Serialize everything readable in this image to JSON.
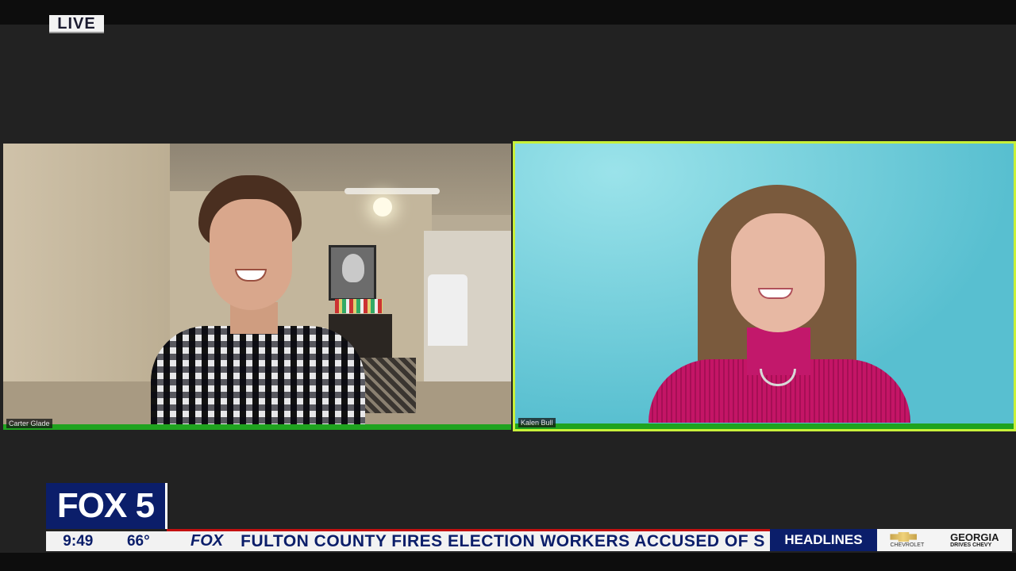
{
  "badge": {
    "live": "LIVE"
  },
  "participants": [
    {
      "name": "Carter Glade",
      "active_speaker": false
    },
    {
      "name": "Kalen Bull",
      "active_speaker": true
    }
  ],
  "lower_third": {
    "station": "FOX 5",
    "time": "9:49",
    "temperature": "66°",
    "ticker_brand": "FOX",
    "ticker_text": "FULTON COUNTY FIRES ELECTION WORKERS ACCUSED OF S",
    "section": "HEADLINES",
    "sponsor_brand": "CHEVROLET",
    "sponsor_title": "GEORGIA",
    "sponsor_subtitle": "DRIVES CHEVY"
  },
  "colors": {
    "active_border": "#c8f03a",
    "audio_bar": "#1fa31f",
    "brand_navy": "#0b1e6a",
    "ticker_red": "#c41010"
  }
}
